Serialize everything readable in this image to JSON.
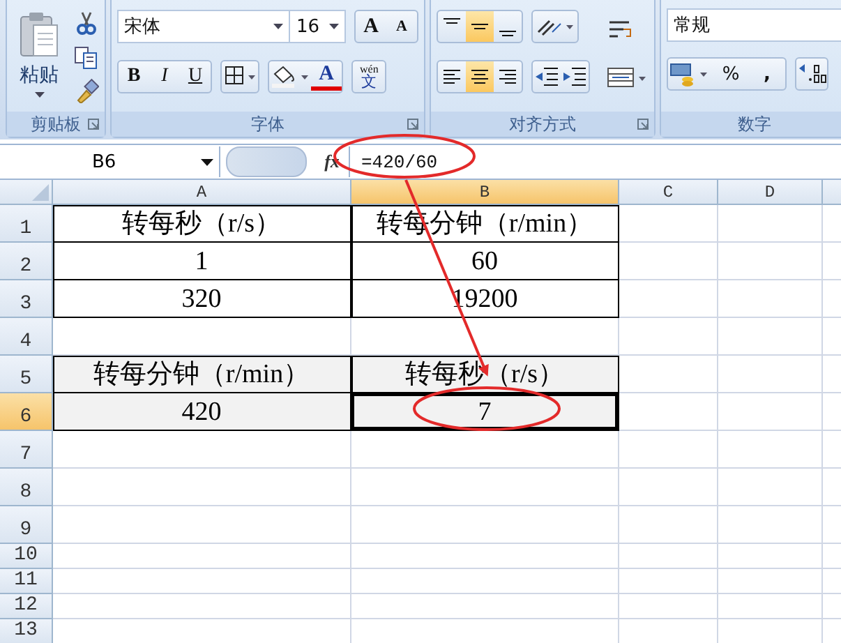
{
  "ribbon": {
    "groups": [
      {
        "kind": "clipboard",
        "label": "剪贴板",
        "paste": "粘贴"
      },
      {
        "kind": "font",
        "label": "字体",
        "font_name": "宋体",
        "font_size": "16",
        "grow": "A",
        "shrink": "A",
        "bold": "B",
        "italic": "I",
        "underline": "U",
        "font_color": "A",
        "phonetic_top": "wén",
        "phonetic": "文"
      },
      {
        "kind": "alignment",
        "label": "对齐方式",
        "vertical_align": [
          {
            "selected": false
          },
          {
            "selected": true
          },
          {
            "selected": false
          }
        ],
        "horizontal_align": [
          {
            "selected": false
          },
          {
            "selected": true
          },
          {
            "selected": false
          }
        ]
      },
      {
        "kind": "number",
        "label": "数字",
        "format": "常规",
        "percent": "%",
        "comma": ","
      }
    ]
  },
  "formula_bar": {
    "name_box": "B6",
    "fx": "fx",
    "formula": "=420/60"
  },
  "sheet": {
    "columns": [
      {
        "label": "A",
        "selected": false
      },
      {
        "label": "B",
        "selected": true
      },
      {
        "label": "C",
        "selected": false
      },
      {
        "label": "D",
        "selected": false
      }
    ],
    "rows": [
      {
        "number": "1",
        "selected": false,
        "bordered": true,
        "shaded": false,
        "cells": [
          "转每秒（r/s）",
          "转每分钟（r/min）"
        ]
      },
      {
        "number": "2",
        "selected": false,
        "bordered": true,
        "shaded": false,
        "cells": [
          "1",
          "60"
        ]
      },
      {
        "number": "3",
        "selected": false,
        "bordered": true,
        "shaded": false,
        "cells": [
          "320",
          "19200"
        ]
      },
      {
        "number": "4",
        "selected": false,
        "bordered": false,
        "shaded": false
      },
      {
        "number": "5",
        "selected": false,
        "bordered": true,
        "shaded": true,
        "cells": [
          "转每分钟（r/min）",
          "转每秒（r/s）"
        ]
      },
      {
        "number": "6",
        "selected": true,
        "bordered": true,
        "shaded": true,
        "cells": [
          "420",
          "7"
        ]
      },
      {
        "number": "7",
        "selected": false,
        "bordered": false,
        "shaded": false
      },
      {
        "number": "8",
        "selected": false,
        "bordered": false,
        "shaded": false
      },
      {
        "number": "9",
        "selected": false,
        "bordered": false,
        "shaded": false
      },
      {
        "number": "10",
        "selected": false,
        "bordered": false,
        "shaded": false
      },
      {
        "number": "11",
        "selected": false,
        "bordered": false,
        "shaded": false
      },
      {
        "number": "12",
        "selected": false,
        "bordered": false,
        "shaded": false
      },
      {
        "number": "13",
        "selected": false,
        "bordered": false,
        "shaded": false
      }
    ]
  }
}
